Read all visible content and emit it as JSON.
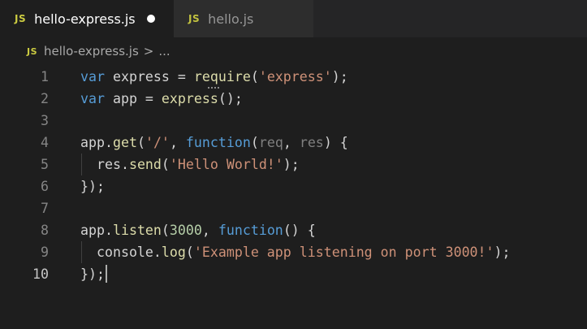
{
  "tabs": [
    {
      "badge": "JS",
      "label": "hello-express.js",
      "active": true,
      "dirty": true
    },
    {
      "badge": "JS",
      "label": "hello.js",
      "active": false,
      "dirty": false
    }
  ],
  "breadcrumb": {
    "badge": "JS",
    "file": "hello-express.js",
    "separator": ">",
    "more": "..."
  },
  "editor": {
    "current_line": 10,
    "lines": [
      {
        "num": "1",
        "tokens": [
          [
            "kw",
            "var"
          ],
          [
            "plain",
            " express = "
          ],
          [
            "fn",
            "require"
          ],
          [
            "plain",
            "("
          ],
          [
            "str",
            "'express'"
          ],
          [
            "plain",
            ");"
          ]
        ]
      },
      {
        "num": "2",
        "tokens": [
          [
            "kw",
            "var"
          ],
          [
            "plain",
            " app = "
          ],
          [
            "fn",
            "express"
          ],
          [
            "plain",
            "();"
          ]
        ]
      },
      {
        "num": "3",
        "tokens": []
      },
      {
        "num": "4",
        "tokens": [
          [
            "plain",
            "app."
          ],
          [
            "fn",
            "get"
          ],
          [
            "plain",
            "("
          ],
          [
            "str",
            "'/'"
          ],
          [
            "plain",
            ", "
          ],
          [
            "kw",
            "function"
          ],
          [
            "plain",
            "("
          ],
          [
            "dim",
            "req"
          ],
          [
            "plain",
            ", "
          ],
          [
            "dim",
            "res"
          ],
          [
            "plain",
            ") {"
          ]
        ]
      },
      {
        "num": "5",
        "tokens": [
          [
            "plain",
            "  res."
          ],
          [
            "fn",
            "send"
          ],
          [
            "plain",
            "("
          ],
          [
            "str",
            "'Hello World!'"
          ],
          [
            "plain",
            ");"
          ]
        ]
      },
      {
        "num": "6",
        "tokens": [
          [
            "plain",
            "});"
          ]
        ]
      },
      {
        "num": "7",
        "tokens": []
      },
      {
        "num": "8",
        "tokens": [
          [
            "plain",
            "app."
          ],
          [
            "fn",
            "listen"
          ],
          [
            "plain",
            "("
          ],
          [
            "num",
            "3000"
          ],
          [
            "plain",
            ", "
          ],
          [
            "kw",
            "function"
          ],
          [
            "plain",
            "() {"
          ]
        ]
      },
      {
        "num": "9",
        "tokens": [
          [
            "plain",
            "  console."
          ],
          [
            "fn",
            "log"
          ],
          [
            "plain",
            "("
          ],
          [
            "str",
            "'Example app listening on port 3000!'"
          ],
          [
            "plain",
            ");"
          ]
        ]
      },
      {
        "num": "10",
        "tokens": [
          [
            "plain",
            "});"
          ]
        ]
      }
    ]
  },
  "colors": {
    "background": "#1e1e1e",
    "keyword": "#569cd6",
    "function": "#dcdcaa",
    "string": "#ce9178",
    "number": "#b5cea8",
    "js_badge": "#cbcb41"
  }
}
